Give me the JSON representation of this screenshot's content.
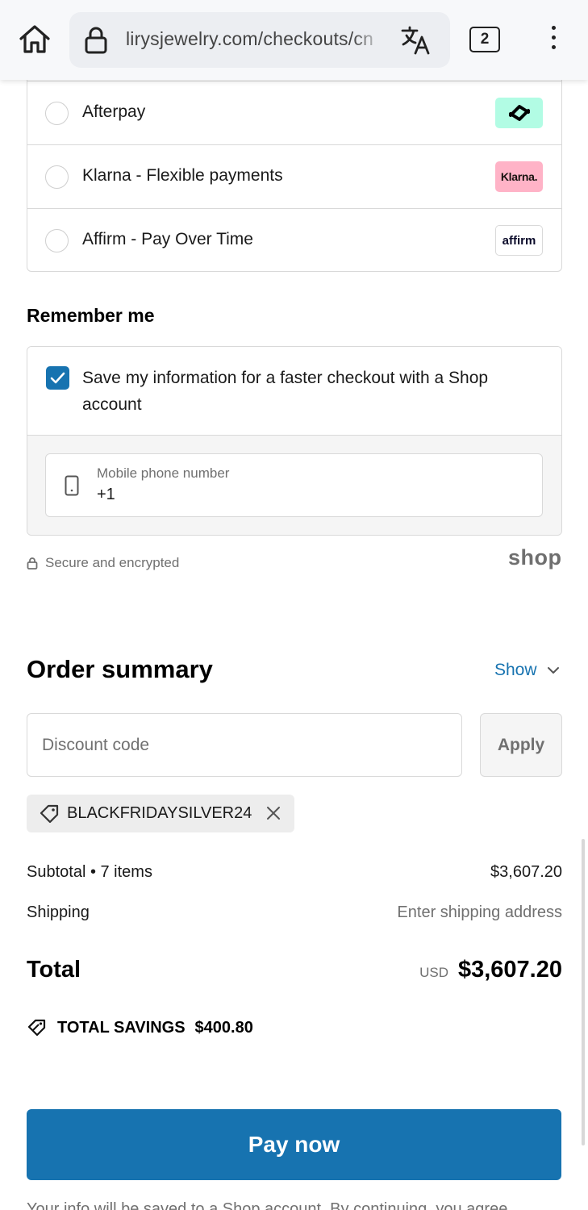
{
  "browser": {
    "url": "lirysjewelry.com/checkouts/cn",
    "tab_count": "2"
  },
  "payment_methods": [
    {
      "label": "Afterpay",
      "logo": "afterpay-logo"
    },
    {
      "label": "Klarna - Flexible payments",
      "logo_text": "Klarna."
    },
    {
      "label": "Affirm - Pay Over Time",
      "logo_text": "affirm"
    }
  ],
  "remember": {
    "title": "Remember me",
    "checkbox_label": "Save my information for a faster checkout with a Shop account",
    "checked": true,
    "phone_label": "Mobile phone number",
    "phone_value": "+1"
  },
  "secure_text": "Secure and encrypted",
  "shop_logo": "shop",
  "order_summary": {
    "title": "Order summary",
    "show_label": "Show",
    "discount_placeholder": "Discount code",
    "apply_label": "Apply",
    "applied_code": "BLACKFRIDAYSILVER24",
    "subtotal_label": "Subtotal • 7 items",
    "subtotal_value": "$3,607.20",
    "shipping_label": "Shipping",
    "shipping_value": "Enter shipping address",
    "total_label": "Total",
    "currency": "USD",
    "total_value": "$3,607.20",
    "savings_label": "TOTAL SAVINGS",
    "savings_value": "$400.80"
  },
  "pay_button": "Pay now",
  "footnote": "Your info will be saved to a Shop account. By continuing, you agree",
  "colors": {
    "accent": "#1773b0",
    "afterpay": "#b2fce4",
    "klarna": "#ffb3c7"
  }
}
